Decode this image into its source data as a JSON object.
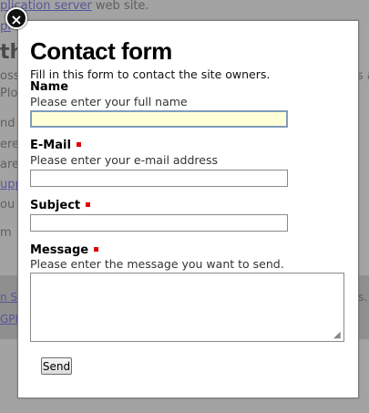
{
  "background": {
    "line1_link": "plication server",
    "line1_rest": " web site.",
    "line2": "pl",
    "heading": "the",
    "line3": "oss",
    "line3_right": "s a",
    "line4": "Plo",
    "line5": "nd",
    "line6": "ere",
    "line7": "are",
    "line8_link": "upp",
    "line9": "ou",
    "line10": "m",
    "footer_link1": "n S",
    "footer_right": "s.",
    "footer_link2": "GPL"
  },
  "modal": {
    "close_icon": "×",
    "title": "Contact form",
    "intro": "Fill in this form to contact the site owners.",
    "fields": {
      "name": {
        "label": "Name",
        "help": "Please enter your full name",
        "value": ""
      },
      "email": {
        "label": "E-Mail",
        "help": "Please enter your e-mail address",
        "value": ""
      },
      "subject": {
        "label": "Subject",
        "value": ""
      },
      "message": {
        "label": "Message",
        "help": "Please enter the message you want to send.",
        "value": ""
      }
    },
    "send_label": "Send"
  },
  "colors": {
    "required_marker": "#e00000",
    "focused_input_bg": "#ffffd8",
    "link": "#53589a"
  }
}
